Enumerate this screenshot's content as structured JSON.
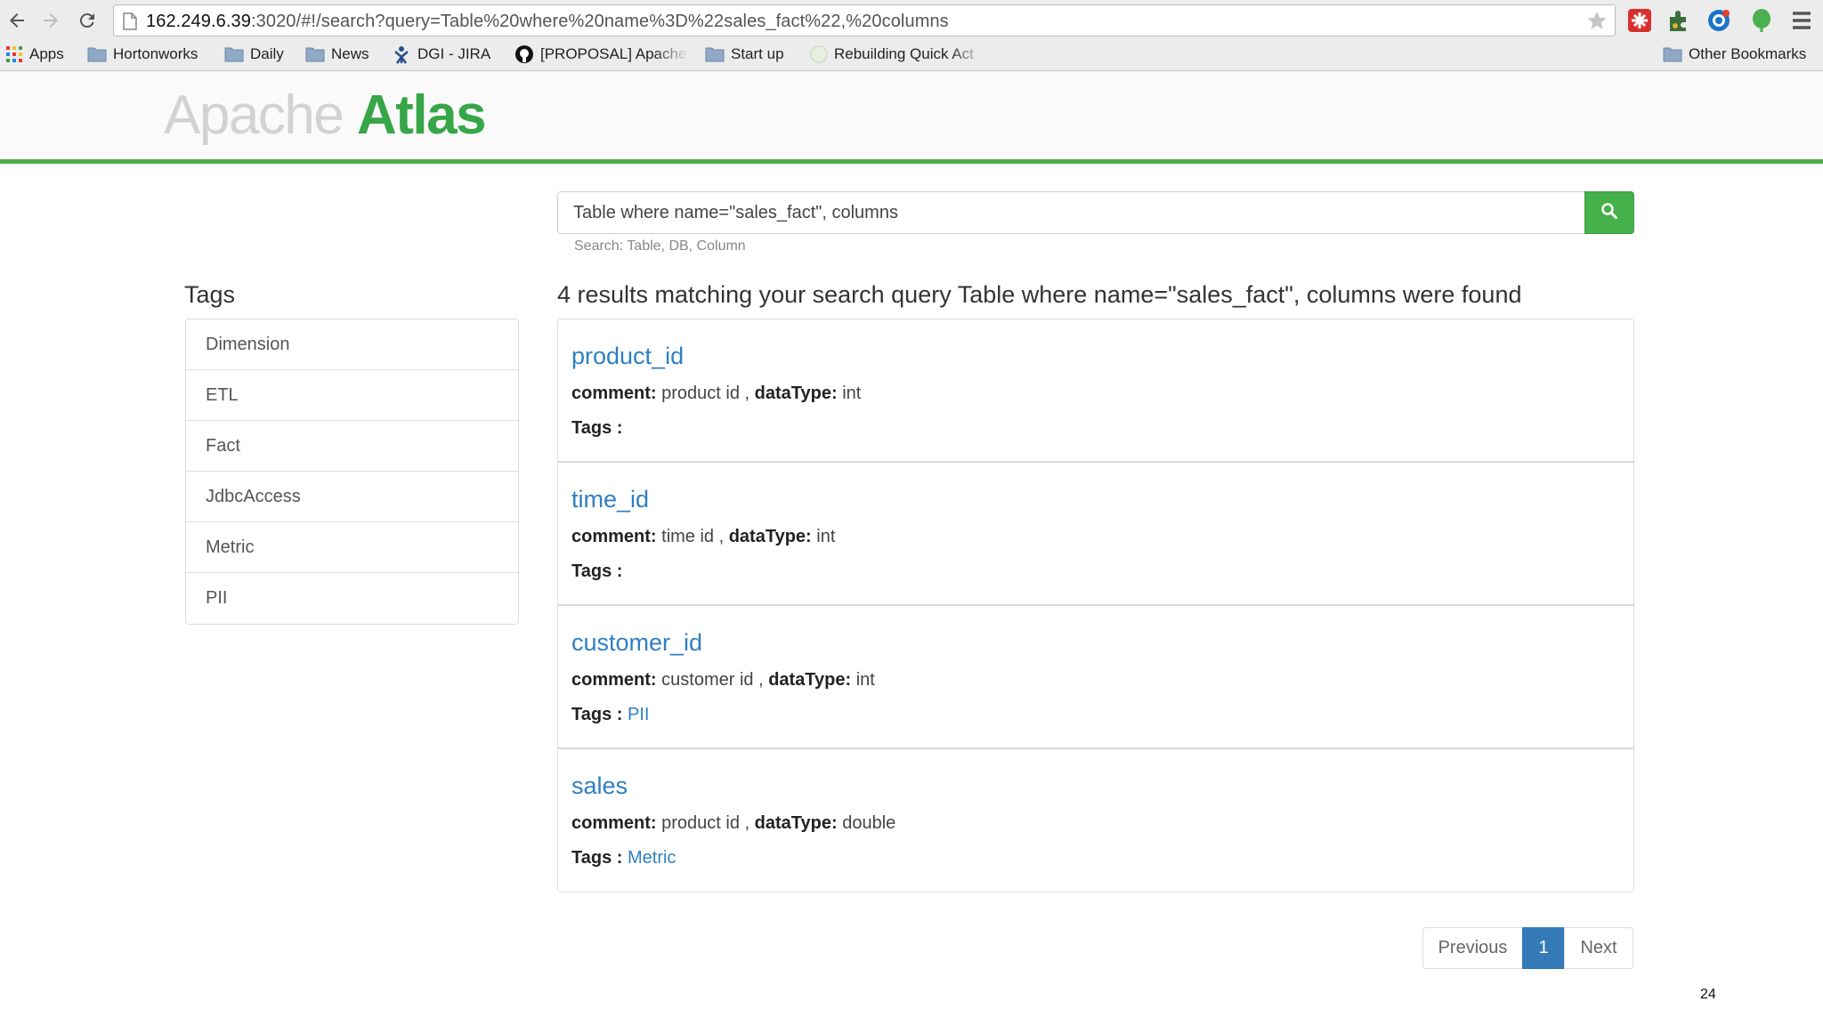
{
  "browser": {
    "url_host": "162.249.6.39",
    "url_path": ":3020/#!/search?query=Table%20where%20name%3D%22sales_fact%22,%20columns",
    "bookmarks": [
      {
        "label": "Apps",
        "icon": "apps-grid-icon"
      },
      {
        "label": "Hortonworks",
        "icon": "folder-icon"
      },
      {
        "label": "Daily",
        "icon": "folder-icon"
      },
      {
        "label": "News",
        "icon": "folder-icon"
      },
      {
        "label": "DGI - JIRA",
        "icon": "jira-icon"
      },
      {
        "label": "[PROPOSAL] Apache",
        "icon": "github-icon"
      },
      {
        "label": "Start up",
        "icon": "folder-icon"
      },
      {
        "label": "Rebuilding Quick Act",
        "icon": "page-icon"
      },
      {
        "label": "Other Bookmarks",
        "icon": "folder-icon"
      }
    ],
    "extension_colors": {
      "red": "#d9302f",
      "blue": "#1a73c9",
      "green": "#4caf50"
    }
  },
  "header": {
    "logo_light": "Apache ",
    "logo_bold": "Atlas",
    "accent_color": "#4cae4c"
  },
  "search": {
    "value": "Table where name=\"sales_fact\", columns",
    "hint": "Search: Table, DB, Column"
  },
  "tags": {
    "title": "Tags",
    "items": [
      "Dimension",
      "ETL",
      "Fact",
      "JdbcAccess",
      "Metric",
      "PII"
    ]
  },
  "results": {
    "summary": "4 results matching your search query Table where name=\"sales_fact\", columns were found",
    "comment_label": "comment:",
    "datatype_label": "dataType:",
    "tags_label": "Tags :",
    "items": [
      {
        "name": "product_id",
        "comment": "product id",
        "dataType": "int",
        "tag": ""
      },
      {
        "name": "time_id",
        "comment": "time id",
        "dataType": "int",
        "tag": ""
      },
      {
        "name": "customer_id",
        "comment": "customer id",
        "dataType": "int",
        "tag": "PII"
      },
      {
        "name": "sales",
        "comment": "product id",
        "dataType": "double",
        "tag": "Metric"
      }
    ]
  },
  "pagination": {
    "previous": "Previous",
    "current": "1",
    "next": "Next"
  },
  "slide_number": "24"
}
